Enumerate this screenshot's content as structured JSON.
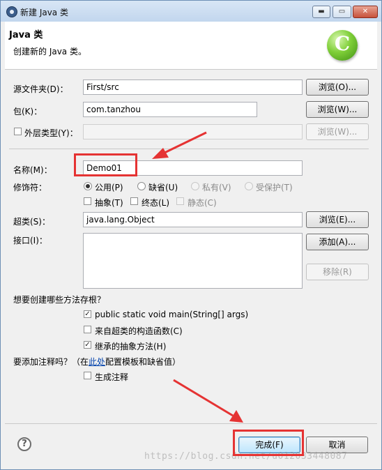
{
  "window": {
    "title": "新建 Java 类",
    "minimize": "▬",
    "maximize": "▭",
    "close": "✕"
  },
  "header": {
    "title": "Java 类",
    "description": "创建新的 Java 类。",
    "logo_letter": "C"
  },
  "form": {
    "source_folder": {
      "label": "源文件夹(D)：",
      "value": "First/src",
      "browse": "浏览(O)..."
    },
    "package": {
      "label": "包(K)：",
      "value": "com.tanzhou",
      "browse": "浏览(W)..."
    },
    "enclosing_type": {
      "label": "外层类型(Y)：",
      "checked": false,
      "value": "",
      "browse": "浏览(W)..."
    },
    "name": {
      "label": "名称(M)：",
      "value": "Demo01"
    },
    "modifiers": {
      "label": "修饰符：",
      "access": [
        {
          "label": "公用(P)",
          "selected": true,
          "enabled": true
        },
        {
          "label": "缺省(U)",
          "selected": false,
          "enabled": true
        },
        {
          "label": "私有(V)",
          "selected": false,
          "enabled": false
        },
        {
          "label": "受保护(T)",
          "selected": false,
          "enabled": false
        }
      ],
      "flags": [
        {
          "label": "抽象(T)",
          "checked": false,
          "enabled": true
        },
        {
          "label": "终态(L)",
          "checked": false,
          "enabled": true
        },
        {
          "label": "静态(C)",
          "checked": false,
          "enabled": false
        }
      ]
    },
    "superclass": {
      "label": "超类(S)：",
      "value": "java.lang.Object",
      "browse": "浏览(E)..."
    },
    "interfaces": {
      "label": "接口(I)：",
      "add": "添加(A)...",
      "remove": "移除(R)"
    },
    "stubs": {
      "question": "想要创建哪些方法存根？",
      "options": [
        {
          "label": "public static void main(String[] args)",
          "checked": true
        },
        {
          "label": "来自超类的构造函数(C)",
          "checked": false
        },
        {
          "label": "继承的抽象方法(H)",
          "checked": true
        }
      ]
    },
    "comments": {
      "question_prefix": "要添加注释吗？（在",
      "question_link": "此处",
      "question_suffix": "配置模板和缺省值）",
      "option": {
        "label": "生成注释",
        "checked": false
      }
    }
  },
  "footer": {
    "help": "?",
    "finish": "完成(F)",
    "cancel": "取消"
  },
  "watermark": "https://blog.csdn.net/u012033448087",
  "colors": {
    "annotation": "#e53333",
    "link": "#0645ad"
  }
}
